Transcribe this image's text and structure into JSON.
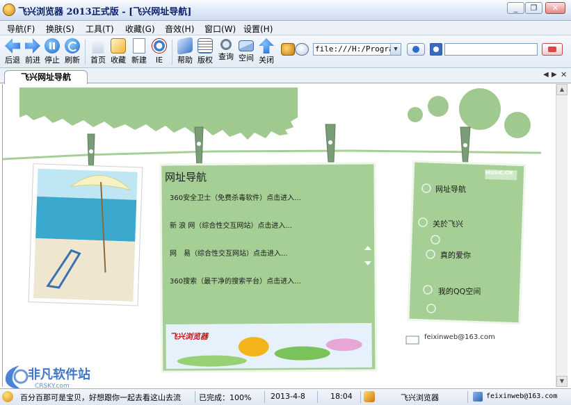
{
  "window": {
    "title": "飞兴浏览器 2013正式版 - [飞兴网址导航]"
  },
  "menu": [
    "导航(F)",
    "换肤(S)",
    "工具(T)",
    "收藏(G)",
    "音效(H)",
    "窗口(W)",
    "设置(H)"
  ],
  "toolbar": [
    {
      "label": "后退",
      "icon": "back-arrow-icon"
    },
    {
      "label": "前进",
      "icon": "forward-arrow-icon"
    },
    {
      "label": "停止",
      "icon": "pause-icon"
    },
    {
      "label": "刷新",
      "icon": "refresh-icon"
    },
    {
      "label": "首页",
      "icon": "home-icon"
    },
    {
      "label": "收藏",
      "icon": "favorites-icon"
    },
    {
      "label": "新建",
      "icon": "new-page-icon"
    },
    {
      "label": "IE",
      "icon": "ie-icon"
    },
    {
      "label": "帮助",
      "icon": "help-book-icon"
    },
    {
      "label": "版权",
      "icon": "copyright-doc-icon"
    },
    {
      "label": "查询",
      "icon": "magnifier-icon"
    },
    {
      "label": "空间",
      "icon": "mail-envelope-icon"
    },
    {
      "label": "关闭",
      "icon": "up-arrow-icon"
    }
  ],
  "address": {
    "value": "file:///H:/Program%"
  },
  "tab": {
    "label": "飞兴网址导航"
  },
  "page": {
    "nav_title": "网址导航",
    "links": [
      "360安全卫士（免费杀毒软件）点击进入...",
      "新 浪 网（综合性交互网站）点击进入...",
      "网　易（综合性交互网站）点击进入...",
      "360搜索（最干净的搜索平台）点击进入..."
    ],
    "banner_text": "飞兴浏览器",
    "side_badge": "MUSIC.CN",
    "side_items": [
      "网址导航",
      "关於飞兴",
      "真的爱你",
      "我的QQ空间"
    ],
    "email": "feixinweb@163.com"
  },
  "status": {
    "message": "百分百那可是宝贝，好想跟你一起去看这山去流",
    "progress": "已完成：100%",
    "date": "2013-4-8",
    "time": "18:04",
    "app_name": "飞兴浏览器",
    "email": "feixinweb@163.com"
  },
  "watermark": {
    "text": "非凡软件站",
    "sub": "CRSKY.com"
  },
  "colors": {
    "page_green": "#9fc98e",
    "panel_green": "#a6cf96",
    "title_blue": "#0a1f6a"
  }
}
